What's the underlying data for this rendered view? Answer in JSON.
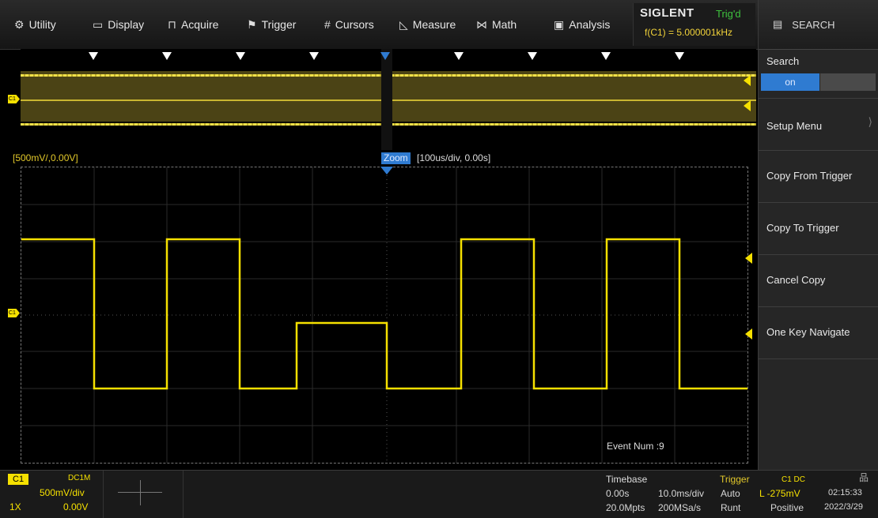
{
  "menu": [
    {
      "icon": "⚙",
      "icon_name": "gear-icon",
      "label": "Utility"
    },
    {
      "icon": "▭",
      "icon_name": "display-icon",
      "label": "Display"
    },
    {
      "icon": "⊓",
      "icon_name": "acquire-icon",
      "label": "Acquire"
    },
    {
      "icon": "⚑",
      "icon_name": "trigger-flag-icon",
      "label": "Trigger"
    },
    {
      "icon": "#",
      "icon_name": "cursors-icon",
      "label": "Cursors"
    },
    {
      "icon": "◺",
      "icon_name": "measure-icon",
      "label": "Measure"
    },
    {
      "icon": "⋈",
      "icon_name": "math-icon",
      "label": "Math"
    },
    {
      "icon": "▣",
      "icon_name": "analysis-icon",
      "label": "Analysis"
    }
  ],
  "brand": {
    "logo": "SIGLENT",
    "trig_status": "Trig'd",
    "freq": "f(C1) = 5.000001kHz"
  },
  "side": {
    "search_label": "SEARCH",
    "search_title": "Search",
    "search_state": "on",
    "items": [
      "Setup Menu",
      "Copy From Trigger",
      "Copy To Trigger",
      "Cancel Copy",
      "One Key Navigate"
    ]
  },
  "screen": {
    "scale": "[500mV/,0.00V]",
    "zoom_tag": "Zoom",
    "zoom_info": "[100us/div, 0.00s]",
    "event_num": "Event Num :9",
    "ch_mark": "C1"
  },
  "status": {
    "ch": "C1",
    "coupling": "DC1M",
    "vdiv": "500mV/div",
    "probe": "1X",
    "offset": "0.00V",
    "timebase_label": "Timebase",
    "tb_delay": "0.00s",
    "tb_div": "10.0ms/div",
    "tb_mem": "20.0Mpts",
    "tb_rate": "200MSa/s",
    "trigger_label": "Trigger",
    "trig_src": "C1 DC",
    "trig_mode": "Auto",
    "trig_level": "L -275mV",
    "trig_type": "Runt",
    "trig_slope": "Positive",
    "time": "02:15:33",
    "date": "2022/3/29"
  },
  "colors": {
    "trace": "#f5e000",
    "accent": "#2f7bd1",
    "trigd": "#3ec23e"
  }
}
